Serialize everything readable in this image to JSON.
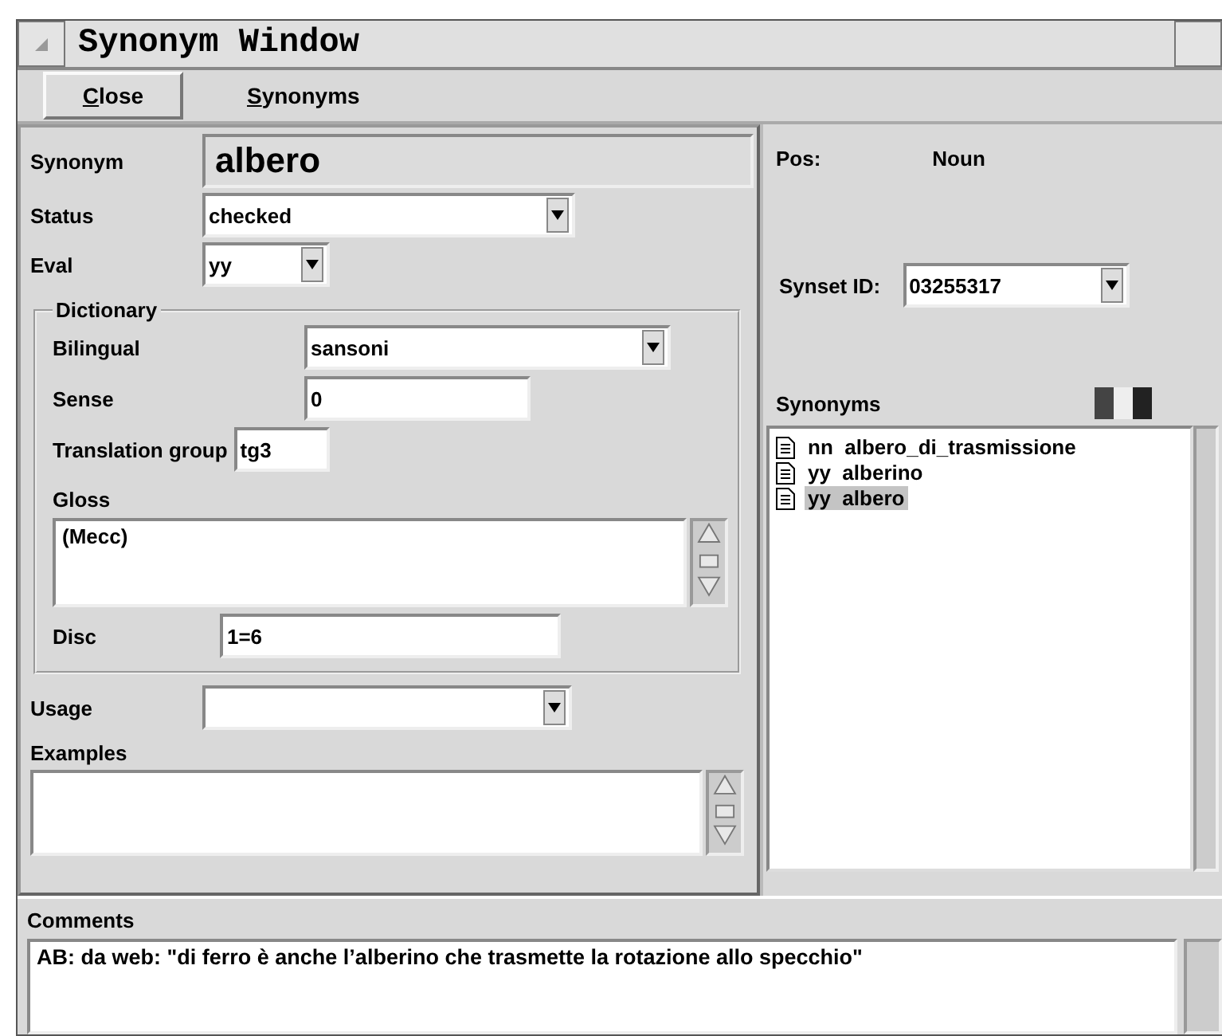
{
  "window": {
    "title": "Synonym Window"
  },
  "menu": [
    {
      "label": "Close",
      "kind": "button"
    },
    {
      "label": "Synonyms",
      "kind": "menu"
    }
  ],
  "synonym": {
    "label": "Synonym",
    "value": "albero"
  },
  "status": {
    "label": "Status",
    "value": "checked"
  },
  "eval": {
    "label": "Eval",
    "value": "yy"
  },
  "dictionary": {
    "title": "Dictionary",
    "bilingual": {
      "label": "Bilingual",
      "value": "sansoni"
    },
    "sense": {
      "label": "Sense",
      "value": "0"
    },
    "translation_group": {
      "label": "Translation group",
      "value": "tg3"
    },
    "gloss": {
      "label": "Gloss",
      "value": "(Mecc)"
    },
    "disc": {
      "label": "Disc",
      "value": "1=6"
    }
  },
  "usage": {
    "label": "Usage"
  },
  "examples": {
    "label": "Examples"
  },
  "pos": {
    "label": "Pos:",
    "value": "Noun"
  },
  "synset_id": {
    "label": "Synset ID:",
    "value": "03255317"
  },
  "synonyms": {
    "label": "Synonyms",
    "items": [
      {
        "eval": "nn",
        "word": "albero_di_trasmissione",
        "selected": false
      },
      {
        "eval": "yy",
        "word": "alberino",
        "selected": false
      },
      {
        "eval": "yy",
        "word": "albero",
        "selected": true
      }
    ]
  },
  "comments": {
    "label": "Comments",
    "value": "AB: da web: \"di ferro è anche l’alberino che trasmette la rotazione allo specchio\""
  }
}
